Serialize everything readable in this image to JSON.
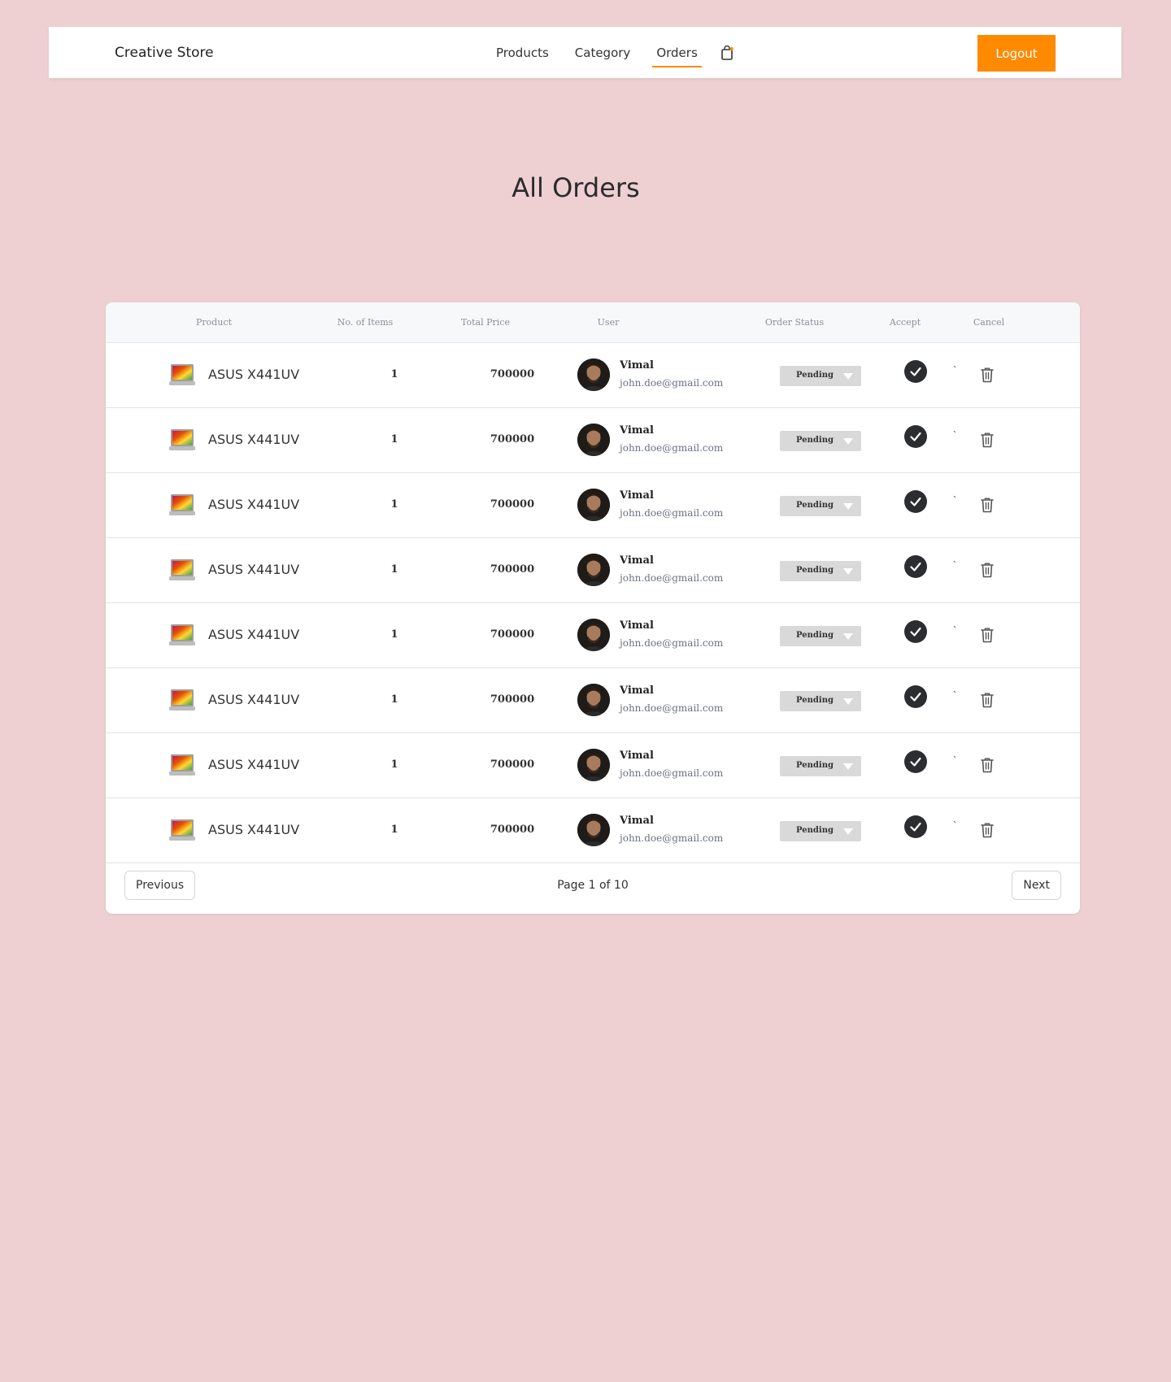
{
  "header": {
    "brand": "Creative Store",
    "nav": [
      {
        "label": "Products",
        "active": false
      },
      {
        "label": "Category",
        "active": false
      },
      {
        "label": "Orders",
        "active": true
      }
    ],
    "cart_icon": "shopping-bag-icon",
    "logout_label": "Logout"
  },
  "page_title": "All Orders",
  "table": {
    "columns": [
      "Product",
      "No. of Items",
      "Total Price",
      "User",
      "Order Status",
      "Accept",
      "Cancel"
    ],
    "rows": [
      {
        "product": "ASUS X441UV",
        "items": "1",
        "price": "700000",
        "user_name": "Vimal",
        "user_email": "john.doe@gmail.com",
        "status": "Pending",
        "tick": "`"
      },
      {
        "product": "ASUS X441UV",
        "items": "1",
        "price": "700000",
        "user_name": "Vimal",
        "user_email": "john.doe@gmail.com",
        "status": "Pending",
        "tick": "`"
      },
      {
        "product": "ASUS X441UV",
        "items": "1",
        "price": "700000",
        "user_name": "Vimal",
        "user_email": "john.doe@gmail.com",
        "status": "Pending",
        "tick": "`"
      },
      {
        "product": "ASUS X441UV",
        "items": "1",
        "price": "700000",
        "user_name": "Vimal",
        "user_email": "john.doe@gmail.com",
        "status": "Pending",
        "tick": "`"
      },
      {
        "product": "ASUS X441UV",
        "items": "1",
        "price": "700000",
        "user_name": "Vimal",
        "user_email": "john.doe@gmail.com",
        "status": "Pending",
        "tick": "`"
      },
      {
        "product": "ASUS X441UV",
        "items": "1",
        "price": "700000",
        "user_name": "Vimal",
        "user_email": "john.doe@gmail.com",
        "status": "Pending",
        "tick": "`"
      },
      {
        "product": "ASUS X441UV",
        "items": "1",
        "price": "700000",
        "user_name": "Vimal",
        "user_email": "john.doe@gmail.com",
        "status": "Pending",
        "tick": "`"
      },
      {
        "product": "ASUS X441UV",
        "items": "1",
        "price": "700000",
        "user_name": "Vimal",
        "user_email": "john.doe@gmail.com",
        "status": "Pending",
        "tick": "`"
      }
    ]
  },
  "pagination": {
    "previous_label": "Previous",
    "page_label": "Page 1 of 10",
    "next_label": "Next"
  },
  "icons": {
    "accept": "check-circle-icon",
    "cancel": "trash-icon",
    "product": "laptop-icon",
    "status_caret": "caret-down-icon"
  },
  "colors": {
    "background": "#eed0d2",
    "accent": "#ff8a00",
    "accept_button": "#2b2d31",
    "status_select": "#d9d9d9"
  }
}
